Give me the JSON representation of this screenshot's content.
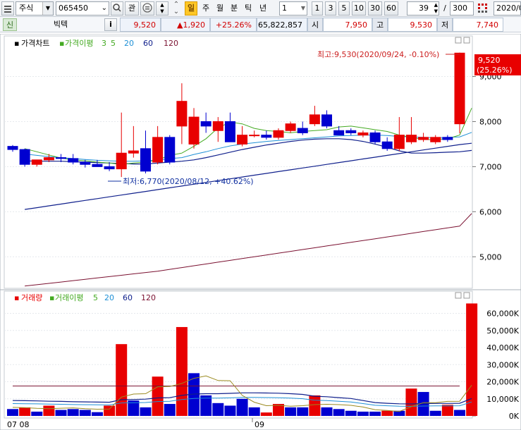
{
  "toolbar": {
    "market": "주식",
    "code": "065450",
    "buttons": {
      "gwan": "관",
      "toggle": "일",
      "week": "주",
      "month": "월",
      "minute": "분",
      "tick": "틱",
      "year": "년"
    },
    "period_unit": "1",
    "periods": [
      "1",
      "3",
      "5",
      "10",
      "30",
      "60"
    ],
    "count": "39",
    "total": "300",
    "date": "2020/0"
  },
  "quote": {
    "badge": "신",
    "name": "빅텍",
    "info_btn": "i",
    "price": "9,520",
    "change": "▲1,920",
    "change_pct": "+25.26%",
    "volume": "65,822,857",
    "open_label": "시",
    "open": "7,950",
    "high_label": "고",
    "high": "9,530",
    "low_label": "저",
    "low": "7,740"
  },
  "colors": {
    "up": "#e80000",
    "down": "#0000d0",
    "ma5": "#44aa22",
    "ma20": "#1e90d6",
    "ma60": "#10208c",
    "ma120": "#7a1030"
  },
  "price_panel": {
    "legend": {
      "title": "가격차트",
      "ma_title": "가격이평",
      "ma3": "3",
      "ma5": "5",
      "ma20": "20",
      "ma60": "60",
      "ma120": "120"
    },
    "max_label": "최고:9,530(2020/09/24, -0.10%)",
    "min_label": "최저:6,770(2020/08/12, +40.62%)",
    "current_price": "9,520",
    "current_pct": "(25.26%)"
  },
  "volume_panel": {
    "legend": {
      "title": "거래량",
      "ma_title": "거래이평",
      "ma5": "5",
      "ma20": "20",
      "ma60": "60",
      "ma120": "120"
    }
  },
  "x_axis": {
    "labels": [
      "07 08",
      "09"
    ]
  },
  "chart_data": [
    {
      "type": "candlestick",
      "y_ticks": [
        "9,000",
        "8,000",
        "7,000",
        "6,000",
        "5,000"
      ],
      "ylim": [
        4300,
        9900
      ],
      "candles": [
        {
          "o": 7450,
          "h": 7480,
          "l": 7330,
          "c": 7380
        },
        {
          "o": 7380,
          "h": 7400,
          "l": 7000,
          "c": 7050
        },
        {
          "o": 7050,
          "h": 7150,
          "l": 7000,
          "c": 7150
        },
        {
          "o": 7150,
          "h": 7280,
          "l": 7100,
          "c": 7200
        },
        {
          "o": 7200,
          "h": 7280,
          "l": 7100,
          "c": 7180
        },
        {
          "o": 7180,
          "h": 7280,
          "l": 7050,
          "c": 7100
        },
        {
          "o": 7100,
          "h": 7150,
          "l": 6980,
          "c": 7050
        },
        {
          "o": 7050,
          "h": 7150,
          "l": 7000,
          "c": 7000
        },
        {
          "o": 7000,
          "h": 7100,
          "l": 6900,
          "c": 6950
        },
        {
          "o": 6950,
          "h": 8200,
          "l": 6770,
          "c": 7300
        },
        {
          "o": 7300,
          "h": 7900,
          "l": 7200,
          "c": 7350
        },
        {
          "o": 7400,
          "h": 7800,
          "l": 6850,
          "c": 6900
        },
        {
          "o": 7100,
          "h": 7900,
          "l": 7050,
          "c": 7650
        },
        {
          "o": 7650,
          "h": 7700,
          "l": 7050,
          "c": 7100
        },
        {
          "o": 7900,
          "h": 8850,
          "l": 7500,
          "c": 8450
        },
        {
          "o": 7500,
          "h": 8300,
          "l": 7400,
          "c": 8100
        },
        {
          "o": 8000,
          "h": 8200,
          "l": 7750,
          "c": 7900
        },
        {
          "o": 7800,
          "h": 8100,
          "l": 7550,
          "c": 8000
        },
        {
          "o": 8000,
          "h": 8200,
          "l": 7550,
          "c": 7550
        },
        {
          "o": 7500,
          "h": 7900,
          "l": 7450,
          "c": 7700
        },
        {
          "o": 7700,
          "h": 7800,
          "l": 7650,
          "c": 7700
        },
        {
          "o": 7700,
          "h": 7800,
          "l": 7600,
          "c": 7650
        },
        {
          "o": 7650,
          "h": 7850,
          "l": 7600,
          "c": 7800
        },
        {
          "o": 7800,
          "h": 8000,
          "l": 7750,
          "c": 7950
        },
        {
          "o": 7850,
          "h": 8000,
          "l": 7700,
          "c": 7750
        },
        {
          "o": 7950,
          "h": 8350,
          "l": 7900,
          "c": 8150
        },
        {
          "o": 8150,
          "h": 8250,
          "l": 7850,
          "c": 7900
        },
        {
          "o": 7800,
          "h": 7900,
          "l": 7700,
          "c": 7700
        },
        {
          "o": 7800,
          "h": 7850,
          "l": 7700,
          "c": 7750
        },
        {
          "o": 7700,
          "h": 7800,
          "l": 7650,
          "c": 7750
        },
        {
          "o": 7750,
          "h": 7800,
          "l": 7500,
          "c": 7550
        },
        {
          "o": 7550,
          "h": 7650,
          "l": 7350,
          "c": 7400
        },
        {
          "o": 7400,
          "h": 8100,
          "l": 7350,
          "c": 7700
        },
        {
          "o": 7550,
          "h": 8100,
          "l": 7500,
          "c": 7700
        },
        {
          "o": 7600,
          "h": 7750,
          "l": 7550,
          "c": 7650
        },
        {
          "o": 7550,
          "h": 7700,
          "l": 7500,
          "c": 7650
        },
        {
          "o": 7650,
          "h": 7700,
          "l": 7550,
          "c": 7600
        },
        {
          "o": 7950,
          "h": 9530,
          "l": 7740,
          "c": 9520
        }
      ],
      "ma5": [
        7400,
        7330,
        7260,
        7190,
        7150,
        7130,
        7100,
        7080,
        7050,
        7080,
        7100,
        7150,
        7250,
        7300,
        7450,
        7620,
        7860,
        7990,
        7950,
        7850,
        7800,
        7780,
        7750,
        7780,
        7800,
        7820,
        7880,
        7900,
        7860,
        7820,
        7780,
        7700,
        7650,
        7600,
        7600,
        7620,
        7700,
        8300
      ],
      "ma20": [
        7280,
        7250,
        7220,
        7200,
        7180,
        7160,
        7140,
        7130,
        7120,
        7120,
        7130,
        7140,
        7180,
        7200,
        7270,
        7330,
        7400,
        7460,
        7500,
        7530,
        7560,
        7580,
        7600,
        7620,
        7640,
        7660,
        7680,
        7690,
        7700,
        7700,
        7690,
        7670,
        7660,
        7650,
        7640,
        7650,
        7660,
        7760
      ],
      "ma60": [
        7130,
        7120,
        7120,
        7120,
        7110,
        7100,
        7090,
        7080,
        7070,
        7060,
        7060,
        7080,
        7100,
        7120,
        7150,
        7200,
        7260,
        7320,
        7380,
        7430,
        7480,
        7520,
        7560,
        7590,
        7610,
        7620,
        7620,
        7600,
        7560,
        7500,
        7430,
        7350,
        7300,
        7300,
        7310,
        7320,
        7330,
        7360
      ],
      "ma120": [
        6050,
        6090,
        6130,
        6170,
        6210,
        6250,
        6290,
        6330,
        6370,
        6410,
        6450,
        6490,
        6530,
        6570,
        6610,
        6650,
        6690,
        6730,
        6770,
        6810,
        6850,
        6890,
        6930,
        6970,
        7010,
        7050,
        7090,
        7130,
        7170,
        7210,
        7250,
        7290,
        7330,
        7370,
        7410,
        7450,
        7490,
        7520
      ],
      "ma240": [
        4350,
        4380,
        4410,
        4440,
        4470,
        4500,
        4530,
        4560,
        4590,
        4620,
        4650,
        4680,
        4720,
        4760,
        4800,
        4840,
        4880,
        4920,
        4960,
        5000,
        5040,
        5080,
        5120,
        5160,
        5200,
        5240,
        5280,
        5320,
        5360,
        5400,
        5440,
        5480,
        5520,
        5560,
        5600,
        5640,
        5680,
        5960
      ]
    },
    {
      "type": "bar",
      "y_ticks": [
        "60,000K",
        "50,000K",
        "40,000K",
        "30,000K",
        "20,000K",
        "10,000K",
        "0K"
      ],
      "ylim": [
        0,
        66000
      ],
      "values": [
        4000,
        5000,
        2500,
        6000,
        3500,
        4000,
        3500,
        2200,
        6000,
        42000,
        9000,
        5000,
        23000,
        7000,
        52000,
        25000,
        12000,
        7500,
        6000,
        10000,
        5000,
        2000,
        7000,
        5000,
        5000,
        12000,
        5000,
        4000,
        3000,
        2500,
        2500,
        3000,
        3000,
        16000,
        14000,
        3000,
        6500,
        3500,
        65800
      ],
      "up": [
        false,
        true,
        false,
        true,
        false,
        false,
        false,
        false,
        true,
        true,
        false,
        false,
        true,
        false,
        true,
        false,
        false,
        false,
        false,
        false,
        false,
        true,
        true,
        false,
        false,
        true,
        false,
        false,
        false,
        false,
        false,
        true,
        false,
        true,
        false,
        false,
        true,
        false,
        true
      ],
      "ma5": [
        5000,
        4800,
        4400,
        4200,
        4500,
        4700,
        4200,
        3900,
        4000,
        11000,
        12800,
        13000,
        17000,
        17200,
        19000,
        22000,
        23400,
        20700,
        20600,
        12000,
        8000,
        6000,
        6200,
        5700,
        6000,
        6600,
        6800,
        6600,
        6200,
        5200,
        3600,
        3200,
        2600,
        5400,
        7800,
        7700,
        8500,
        8600,
        18000
      ],
      "ma20": [
        9000,
        8900,
        8800,
        8600,
        8500,
        8300,
        8200,
        8100,
        8000,
        9500,
        9600,
        9800,
        10500,
        10700,
        12000,
        12800,
        13000,
        13000,
        13200,
        13500,
        13500,
        13400,
        13300,
        13000,
        12600,
        11500,
        11200,
        10700,
        10200,
        9000,
        7800,
        7400,
        7100,
        7000,
        7200,
        7300,
        7300,
        7400,
        10200
      ]
    }
  ]
}
